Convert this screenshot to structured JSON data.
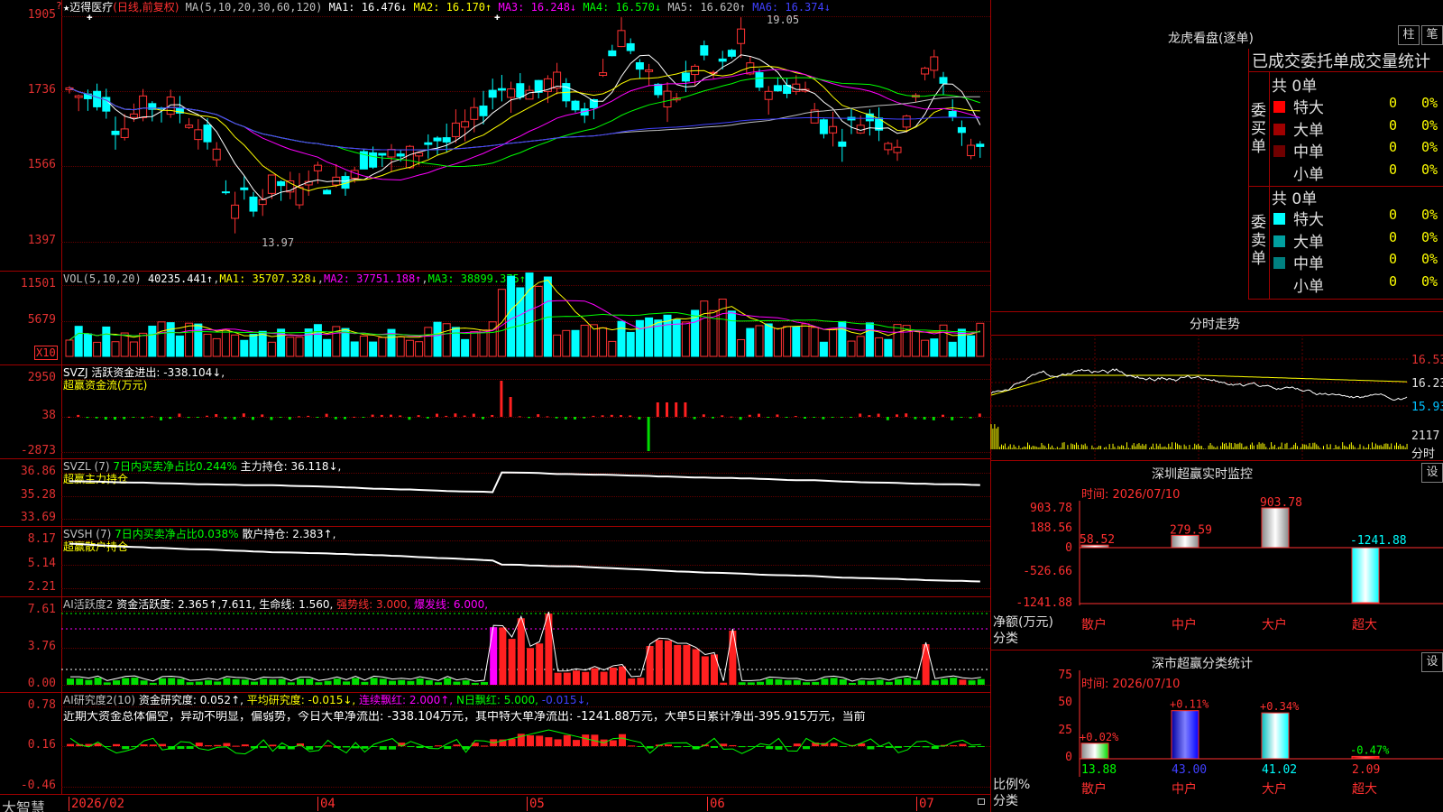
{
  "header": {
    "stock_name": "迈得医疗",
    "period": "(日线,前复权)",
    "ma_label": "MA(5,10,20,30,60,120)",
    "ma": [
      {
        "k": "MA1",
        "v": "16.476↓",
        "c": "#ffffff"
      },
      {
        "k": "MA2",
        "v": "16.170↑",
        "c": "#ffff00"
      },
      {
        "k": "MA3",
        "v": "16.248↓",
        "c": "#ff00ff"
      },
      {
        "k": "MA4",
        "v": "16.570↓",
        "c": "#00ff00"
      },
      {
        "k": "MA5",
        "v": "16.620↑",
        "c": "#c0c0c0"
      },
      {
        "k": "MA6",
        "v": "16.374↓",
        "c": "#4040ff"
      }
    ],
    "high_label": "19.05",
    "low_label": "13.97"
  },
  "price_axis": [
    "1905",
    "1736",
    "1566",
    "1397"
  ],
  "vol": {
    "legend": "VOL(5,10,20)",
    "value": "40235.441↑",
    "ma1": "MA1: 35707.328↓",
    "ma2": "MA2: 37751.188↑",
    "ma3": "MA3: 38899.375↑",
    "axis": [
      "11501",
      "5679"
    ],
    "unit": "X10"
  },
  "svzj": {
    "legend": "SVZJ  活跃资金进出: -338.104↓,",
    "sub": "超赢资金流(万元)",
    "axis": [
      "2950",
      "38",
      "-2873"
    ]
  },
  "svzl": {
    "legend_a": "SVZL (7)",
    "legend_b": "7日内买卖净占比0.244%",
    "legend_c": "主力持仓: 36.118↓,",
    "sub": "超赢主力持仓",
    "axis": [
      "36.86",
      "35.28",
      "33.69"
    ]
  },
  "svsh": {
    "legend_a": "SVSH (7)",
    "legend_b": "7日内买卖净占比0.038%",
    "legend_c": "散户持仓: 2.383↑,",
    "sub": "超赢散户持仓",
    "axis": [
      "8.17",
      "5.14",
      "2.21"
    ]
  },
  "ai1": {
    "legend_a": "AI活跃度2",
    "legend_b": "资金活跃度: 2.365↑,7.611,",
    "legend_c": "生命线: 1.560,",
    "legend_d": "强势线: 3.000,",
    "legend_e": "爆发线: 6.000,",
    "axis": [
      "7.61",
      "3.76",
      "0.00"
    ]
  },
  "ai2": {
    "legend_a": "AI研究度2(10)",
    "legend_b": "资金研究度: 0.052↑,",
    "legend_c": "平均研究度: -0.015↓,",
    "legend_d": "连续飘红: 2.000↑,",
    "legend_e": "N日飘红: 5.000,",
    "legend_f": "-0.015↓,",
    "comment": "近期大资金总体偏空，异动不明显，偏弱势，今日大单净流出: -338.104万元，其中特大单净流出: -1241.88万元，大单5日累计净出-395.915万元，当前",
    "axis": [
      "0.78",
      "0.16",
      "-0.46"
    ]
  },
  "xaxis": {
    "brand": "大智慧",
    "labels": [
      "2026/02",
      "04",
      "05",
      "06",
      "07"
    ]
  },
  "longhu": {
    "title": "龙虎看盘(逐单)",
    "btn1": "柱",
    "btn2": "笔",
    "header": "已成交委托单成交量统计",
    "buy_label": "委买单",
    "sell_label": "委卖单",
    "buy_total": "共 0单",
    "sell_total": "共 0单",
    "buy_rows": [
      {
        "name": "特大",
        "v": "0",
        "p": "0%",
        "c": "#ff0000"
      },
      {
        "name": "大单",
        "v": "0",
        "p": "0%",
        "c": "#a00000"
      },
      {
        "name": "中单",
        "v": "0",
        "p": "0%",
        "c": "#700000"
      },
      {
        "name": "小单",
        "v": "0",
        "p": "0%",
        "c": ""
      }
    ],
    "sell_rows": [
      {
        "name": "特大",
        "v": "0",
        "p": "0%",
        "c": "#00ffff"
      },
      {
        "name": "大单",
        "v": "0",
        "p": "0%",
        "c": "#00a0a0"
      },
      {
        "name": "中单",
        "v": "0",
        "p": "0%",
        "c": "#008080"
      },
      {
        "name": "小单",
        "v": "0",
        "p": "0%",
        "c": ""
      }
    ]
  },
  "intraday": {
    "title": "分时走势",
    "axis": [
      "16.53",
      "16.23",
      "15.93"
    ],
    "vol_label": "2117",
    "vol_unit": "分时"
  },
  "sz_monitor": {
    "title": "深圳超赢实时监控",
    "btn": "设",
    "time": "时间: 2026/07/10",
    "axis": [
      "903.78",
      "188.56",
      "0",
      "-526.66",
      "-1241.88"
    ],
    "ylabel": "净额(万元)",
    "xlabel": "分类",
    "cats": [
      "散户",
      "中户",
      "大户",
      "超大"
    ],
    "values": [
      58.52,
      279.59,
      903.78,
      -1241.88
    ],
    "labels": [
      "58.52",
      "279.59",
      "903.78",
      "-1241.88"
    ]
  },
  "sz_class": {
    "title": "深市超赢分类统计",
    "btn": "设",
    "time": "时间: 2026/07/10",
    "axis": [
      "75",
      "50",
      "25",
      "0"
    ],
    "ylabel": "比例%",
    "xlabel": "分类",
    "cats": [
      "散户",
      "中户",
      "大户",
      "超大"
    ],
    "values": [
      13.88,
      43.0,
      41.02,
      2.09
    ],
    "vals_label": [
      "13.88",
      "43.00",
      "41.02",
      "2.09"
    ],
    "chg": [
      "+0.02%",
      "+0.11%",
      "+0.34%",
      "-0.47%"
    ]
  }
}
